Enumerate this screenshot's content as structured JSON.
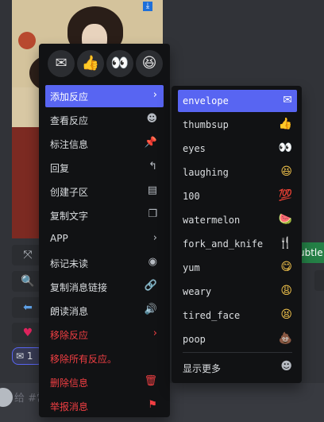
{
  "quick_reactions": [
    {
      "name": "envelope",
      "glyph": "✉"
    },
    {
      "name": "thumbsup",
      "glyph": "👍"
    },
    {
      "name": "eyes",
      "glyph": "👀"
    },
    {
      "name": "laughing",
      "glyph": "😆"
    }
  ],
  "menu": {
    "items": [
      {
        "label": "添加反应",
        "icon": "chevron-right",
        "glyph": "›",
        "active": true
      },
      {
        "label": "查看反应",
        "icon": "smiley",
        "glyph": "☻"
      },
      {
        "label": "标注信息",
        "icon": "pin",
        "glyph": "📌"
      },
      {
        "label": "回复",
        "icon": "reply",
        "glyph": "↰"
      },
      {
        "label": "创建子区",
        "icon": "thread",
        "glyph": "▤"
      },
      {
        "label": "复制文字",
        "icon": "copy",
        "glyph": "❐"
      },
      {
        "label": "APP",
        "icon": "chevron-right",
        "glyph": "›"
      },
      {
        "label": "标记未读",
        "icon": "mark-unread",
        "glyph": "◉"
      },
      {
        "label": "复制消息链接",
        "icon": "link",
        "glyph": "🔗"
      },
      {
        "label": "朗读消息",
        "icon": "speak",
        "glyph": "🔊"
      },
      {
        "label": "移除反应",
        "icon": "chevron-right",
        "glyph": "›",
        "danger": true
      },
      {
        "label": "移除所有反应。",
        "icon": "",
        "glyph": "",
        "danger": true
      },
      {
        "label": "删除信息",
        "icon": "trash",
        "glyph": "🗑",
        "danger": true
      },
      {
        "label": "举报消息",
        "icon": "flag",
        "glyph": "⚑",
        "danger": true
      }
    ]
  },
  "submenu": {
    "items": [
      {
        "label": "envelope",
        "glyph": "✉",
        "active": true
      },
      {
        "label": "thumbsup",
        "glyph": "👍"
      },
      {
        "label": "eyes",
        "glyph": "👀"
      },
      {
        "label": "laughing",
        "glyph": "😆"
      },
      {
        "label": "100",
        "glyph": "💯"
      },
      {
        "label": "watermelon",
        "glyph": "🍉"
      },
      {
        "label": "fork_and_knife",
        "glyph": "🍴"
      },
      {
        "label": "yum",
        "glyph": "😋"
      },
      {
        "label": "weary",
        "glyph": "😩"
      },
      {
        "label": "tired_face",
        "glyph": "😫"
      },
      {
        "label": "poop",
        "glyph": "💩"
      }
    ],
    "show_more": {
      "label": "显示更多",
      "glyph": "☻"
    }
  },
  "background": {
    "green_tag": "ubtle",
    "reaction_pill": "✉ 1",
    "composer_placeholder": "给 #常"
  },
  "colors": {
    "accent": "#5865f2",
    "danger": "#f23f43",
    "menu_bg": "#111214"
  }
}
